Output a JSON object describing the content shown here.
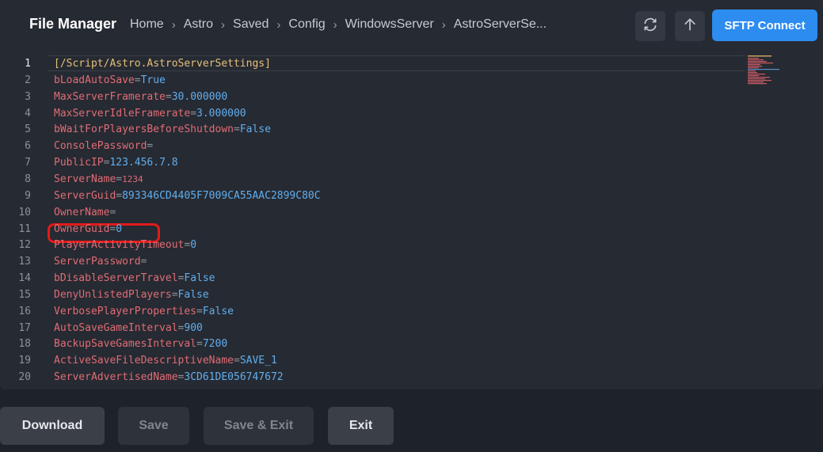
{
  "header": {
    "title": "File Manager",
    "breadcrumb": [
      "Home",
      "Astro",
      "Saved",
      "Config",
      "WindowsServer",
      "AstroServerSe..."
    ],
    "sftp_label": "SFTP Connect"
  },
  "editor": {
    "lines": [
      {
        "n": "1",
        "key": "[/Script/Astro.AstroServerSettings]",
        "eq": "",
        "val": ""
      },
      {
        "n": "2",
        "key": "bLoadAutoSave",
        "eq": "=",
        "val": "True"
      },
      {
        "n": "3",
        "key": "MaxServerFramerate",
        "eq": "=",
        "val": "30.000000"
      },
      {
        "n": "4",
        "key": "MaxServerIdleFramerate",
        "eq": "=",
        "val": "3.000000"
      },
      {
        "n": "5",
        "key": "bWaitForPlayersBeforeShutdown",
        "eq": "=",
        "val": "False"
      },
      {
        "n": "6",
        "key": "ConsolePassword",
        "eq": "=",
        "val": ""
      },
      {
        "n": "7",
        "key": "PublicIP",
        "eq": "=",
        "val": "123.456.7.8"
      },
      {
        "n": "8",
        "key": "ServerName",
        "eq": "=",
        "val": "1234"
      },
      {
        "n": "9",
        "key": "ServerGuid",
        "eq": "=",
        "val": "893346CD4405F7009CA55AAC2899C80C"
      },
      {
        "n": "10",
        "key": "OwnerName",
        "eq": "=",
        "val": ""
      },
      {
        "n": "11",
        "key": "OwnerGuid",
        "eq": "=",
        "val": "0"
      },
      {
        "n": "12",
        "key": "PlayerActivityTimeout",
        "eq": "=",
        "val": "0"
      },
      {
        "n": "13",
        "key": "ServerPassword",
        "eq": "=",
        "val": ""
      },
      {
        "n": "14",
        "key": "bDisableServerTravel",
        "eq": "=",
        "val": "False"
      },
      {
        "n": "15",
        "key": "DenyUnlistedPlayers",
        "eq": "=",
        "val": "False"
      },
      {
        "n": "16",
        "key": "VerbosePlayerProperties",
        "eq": "=",
        "val": "False"
      },
      {
        "n": "17",
        "key": "AutoSaveGameInterval",
        "eq": "=",
        "val": "900"
      },
      {
        "n": "18",
        "key": "BackupSaveGamesInterval",
        "eq": "=",
        "val": "7200"
      },
      {
        "n": "19",
        "key": "ActiveSaveFileDescriptiveName",
        "eq": "=",
        "val": "SAVE_1"
      },
      {
        "n": "20",
        "key": "ServerAdvertisedName",
        "eq": "=",
        "val": "3CD61DE056747672"
      }
    ]
  },
  "footer": {
    "download": "Download",
    "save": "Save",
    "save_exit": "Save & Exit",
    "exit": "Exit"
  },
  "colors": {
    "accent": "#2d8cf0",
    "highlight": "#e21b1b",
    "key": "#e06c75",
    "value": "#61aeee"
  },
  "icons": {
    "refresh": "refresh-icon",
    "upload": "arrow-up-icon",
    "separator": "chevron-right-icon"
  }
}
